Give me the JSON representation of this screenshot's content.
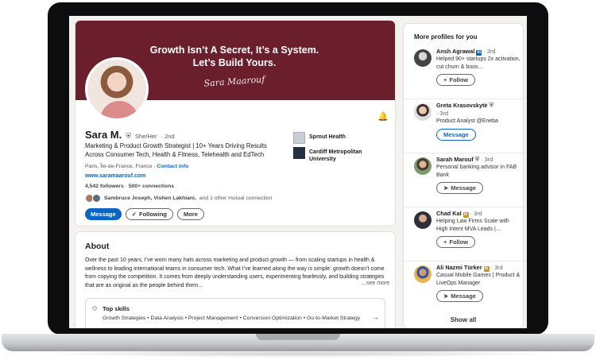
{
  "banner": {
    "line1": "Growth Isn’t A Secret, It’s a System.",
    "line2": "Let’s Build Yours.",
    "signature": "Sara Maarouf",
    "color": "#6b1e2c"
  },
  "profile": {
    "name": "Sara M.",
    "pronouns": "She/Her",
    "degree": "· 2nd",
    "headline": "Marketing & Product Growth Strategist | 10+ Years Driving Results Across Consumer Tech, Health & Fitness, Telehealth and EdTech",
    "location": "Paris, Île-de-France, France ·",
    "contact_info": "Contact info",
    "website": "www.saramaarouf.com",
    "followers": "4,542 followers",
    "connections": "500+ connections",
    "mutual_names": "Sambruce Joseph, Vishen Lakhiani,",
    "mutual_rest": "and 1 other mutual connection",
    "buttons": {
      "message": "Message",
      "following": "Following",
      "more": "More"
    },
    "orgs": [
      {
        "name": "Sprout Health"
      },
      {
        "name": "Cardiff Metropolitan University"
      }
    ],
    "icons": {
      "bell": "bell-icon",
      "verified": "verified-shield-icon",
      "check": "check-icon"
    }
  },
  "about": {
    "title": "About",
    "text": "Over the past 10 years, I’ve worn many hats across marketing and product growth — from scaling startups in health & wellness to leading international teams in consumer tech. What I’ve learned along the way is simple: growth doesn’t come from copying the competition. It comes from deeply understanding users, experimenting fearlessly, and building strategies that are as original as the people behind them…",
    "see_more": "…see more",
    "top_skills_title": "Top skills",
    "top_skills": "Growth Strategies • Data Analysis • Project Management • Conversion Optimization • Go-to-Market Strategy"
  },
  "sidebar": {
    "title": "More profiles for you",
    "people": [
      {
        "name": "Ansh Agrawal",
        "degree": "· 3rd",
        "headline": "Helped 90+ startups 2x activation, cut churn & boos…",
        "button": "Follow",
        "button_icon": "+"
      },
      {
        "name": "Greta Krasovskytė",
        "degree": "· 3rd",
        "headline": "Product Analyst @Eneba",
        "button": "Message",
        "button_icon": ""
      },
      {
        "name": "Sarah Marouf",
        "degree": "· 3rd",
        "headline": "Personal banking advisor in FAB Bank",
        "button": "Message",
        "button_icon": "➤"
      },
      {
        "name": "Chad Kal",
        "degree": "· 3rd",
        "headline": "Helping Law Firms Scale with High Intent MVA Leads |…",
        "button": "Follow",
        "button_icon": "+"
      },
      {
        "name": "Ali Nazmi Türker",
        "degree": "· 3rd",
        "headline": "Casual Mobile Games | Product & LiveOps Manager",
        "button": "Message",
        "button_icon": "➤"
      }
    ],
    "show_all": "Show all"
  },
  "colors": {
    "accent": "#0a66c2",
    "page_bg": "#f3f2ee"
  }
}
